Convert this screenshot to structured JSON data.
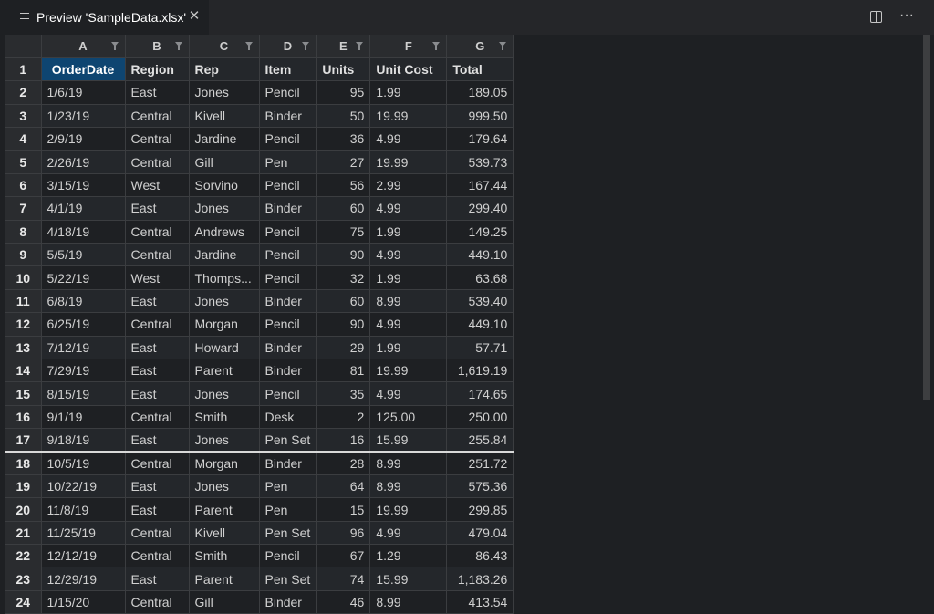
{
  "tab": {
    "title": "Preview 'SampleData.xlsx'",
    "close_glyph": "✕",
    "icon": "preview-icon"
  },
  "actions": {
    "split_icon": "split-editor-icon",
    "more_glyph": "···"
  },
  "columns": [
    "A",
    "B",
    "C",
    "D",
    "E",
    "F",
    "G"
  ],
  "header_row": {
    "num": "1",
    "cells": [
      "OrderDate",
      "Region",
      "Rep",
      "Item",
      "Units",
      "Unit Cost",
      "Total"
    ]
  },
  "rows": [
    {
      "num": "2",
      "cells": [
        "1/6/19",
        "East",
        "Jones",
        "Pencil",
        "95",
        "1.99",
        "189.05"
      ]
    },
    {
      "num": "3",
      "cells": [
        "1/23/19",
        "Central",
        "Kivell",
        "Binder",
        "50",
        "19.99",
        "999.50"
      ]
    },
    {
      "num": "4",
      "cells": [
        "2/9/19",
        "Central",
        "Jardine",
        "Pencil",
        "36",
        "4.99",
        "179.64"
      ]
    },
    {
      "num": "5",
      "cells": [
        "2/26/19",
        "Central",
        "Gill",
        "Pen",
        "27",
        "19.99",
        "539.73"
      ]
    },
    {
      "num": "6",
      "cells": [
        "3/15/19",
        "West",
        "Sorvino",
        "Pencil",
        "56",
        "2.99",
        "167.44"
      ]
    },
    {
      "num": "7",
      "cells": [
        "4/1/19",
        "East",
        "Jones",
        "Binder",
        "60",
        "4.99",
        "299.40"
      ]
    },
    {
      "num": "8",
      "cells": [
        "4/18/19",
        "Central",
        "Andrews",
        "Pencil",
        "75",
        "1.99",
        "149.25"
      ]
    },
    {
      "num": "9",
      "cells": [
        "5/5/19",
        "Central",
        "Jardine",
        "Pencil",
        "90",
        "4.99",
        "449.10"
      ]
    },
    {
      "num": "10",
      "cells": [
        "5/22/19",
        "West",
        "Thomps...",
        "Pencil",
        "32",
        "1.99",
        "63.68"
      ]
    },
    {
      "num": "11",
      "cells": [
        "6/8/19",
        "East",
        "Jones",
        "Binder",
        "60",
        "8.99",
        "539.40"
      ]
    },
    {
      "num": "12",
      "cells": [
        "6/25/19",
        "Central",
        "Morgan",
        "Pencil",
        "90",
        "4.99",
        "449.10"
      ]
    },
    {
      "num": "13",
      "cells": [
        "7/12/19",
        "East",
        "Howard",
        "Binder",
        "29",
        "1.99",
        "57.71"
      ]
    },
    {
      "num": "14",
      "cells": [
        "7/29/19",
        "East",
        "Parent",
        "Binder",
        "81",
        "19.99",
        "1,619.19"
      ]
    },
    {
      "num": "15",
      "cells": [
        "8/15/19",
        "East",
        "Jones",
        "Pencil",
        "35",
        "4.99",
        "174.65"
      ]
    },
    {
      "num": "16",
      "cells": [
        "9/1/19",
        "Central",
        "Smith",
        "Desk",
        "2",
        "125.00",
        "250.00"
      ]
    },
    {
      "num": "17",
      "cells": [
        "9/18/19",
        "East",
        "Jones",
        "Pen Set",
        "16",
        "15.99",
        "255.84"
      ]
    },
    {
      "num": "18",
      "cells": [
        "10/5/19",
        "Central",
        "Morgan",
        "Binder",
        "28",
        "8.99",
        "251.72"
      ]
    },
    {
      "num": "19",
      "cells": [
        "10/22/19",
        "East",
        "Jones",
        "Pen",
        "64",
        "8.99",
        "575.36"
      ]
    },
    {
      "num": "20",
      "cells": [
        "11/8/19",
        "East",
        "Parent",
        "Pen",
        "15",
        "19.99",
        "299.85"
      ]
    },
    {
      "num": "21",
      "cells": [
        "11/25/19",
        "Central",
        "Kivell",
        "Pen Set",
        "96",
        "4.99",
        "479.04"
      ]
    },
    {
      "num": "22",
      "cells": [
        "12/12/19",
        "Central",
        "Smith",
        "Pencil",
        "67",
        "1.29",
        "86.43"
      ]
    },
    {
      "num": "23",
      "cells": [
        "12/29/19",
        "East",
        "Parent",
        "Pen Set",
        "74",
        "15.99",
        "1,183.26"
      ]
    },
    {
      "num": "24",
      "cells": [
        "1/15/20",
        "Central",
        "Gill",
        "Binder",
        "46",
        "8.99",
        "413.54"
      ]
    }
  ],
  "colors": {
    "selected_cell": "#0e4571",
    "background": "#1e2023"
  }
}
